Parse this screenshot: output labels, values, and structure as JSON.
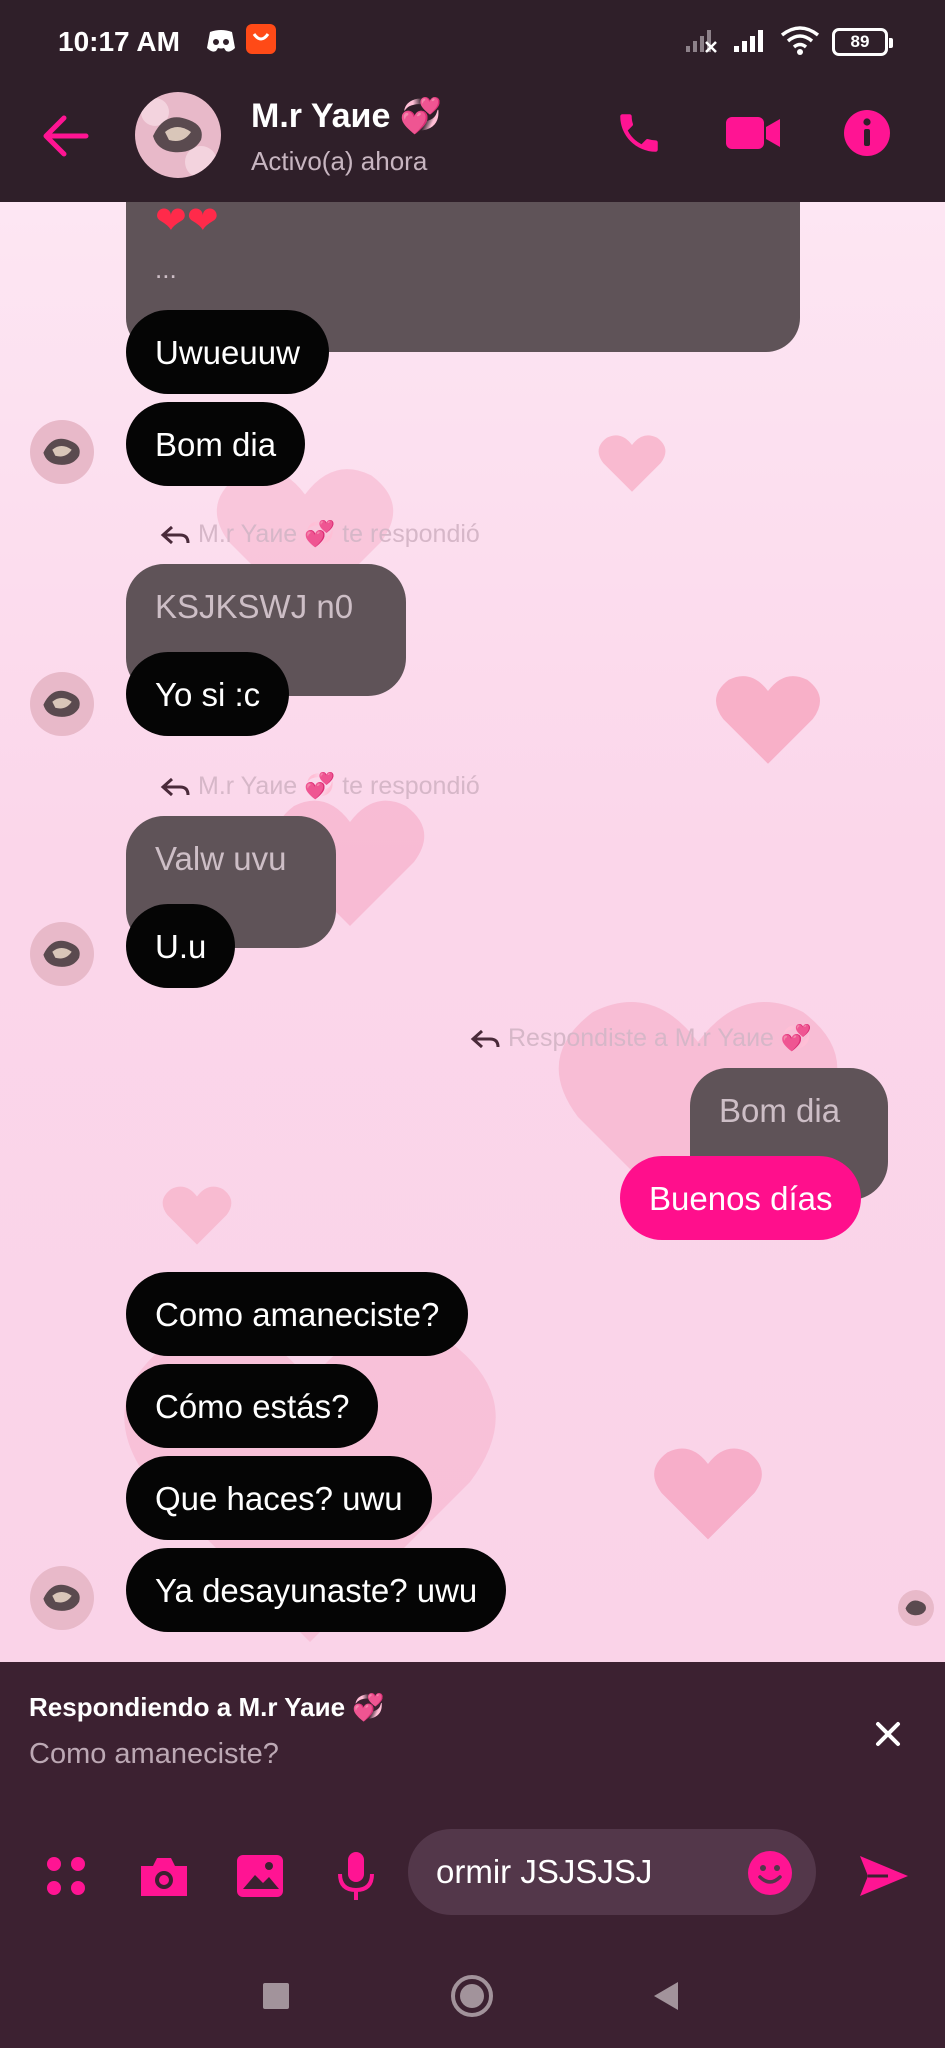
{
  "status_bar": {
    "time": "10:17 AM",
    "battery": "89"
  },
  "header": {
    "contact_name": "M.r Yaие 💞",
    "contact_status": "Activo(a) ahora",
    "icons": [
      "back-arrow-icon",
      "phone-icon",
      "video-camera-icon",
      "info-icon"
    ]
  },
  "messages": {
    "prev_partial": "❤❤",
    "prev_ellipsis": "...",
    "m1": "Uwueuuw",
    "m2": "Bom dia",
    "reply1_label": "M.r Yaие 💞 te respondió",
    "reply1_quote": "KSJKSWJ n0",
    "m3": "Yo si :c",
    "reply2_label": "M.r Yaие 💞 te respondió",
    "reply2_quote": "Valw uvu",
    "m4": "U.u",
    "reply3_label": "Respondiste a M.r Yaие 💞",
    "reply3_quote": "Bom dia",
    "m5_sent": "Buenos días",
    "m6": "Como amaneciste?",
    "m7": "Cómo estás?",
    "m8": "Que haces? uwu",
    "m9": "Ya desayunaste? uwu"
  },
  "reply_bar": {
    "title": "Respondiendo a M.r Yaие 💞",
    "preview": "Como amaneciste?"
  },
  "composer": {
    "input_value": "ormir JSJSJSJ",
    "icons": [
      "apps-icon",
      "camera-icon",
      "gallery-icon",
      "microphone-icon",
      "emoji-icon",
      "send-icon"
    ]
  },
  "colors": {
    "accent": "#ff0f8c",
    "header_bg": "#2f1f29",
    "bottom_bg": "#3c2131",
    "bubble_black": "#050505",
    "bubble_grey": "#5f5358"
  }
}
